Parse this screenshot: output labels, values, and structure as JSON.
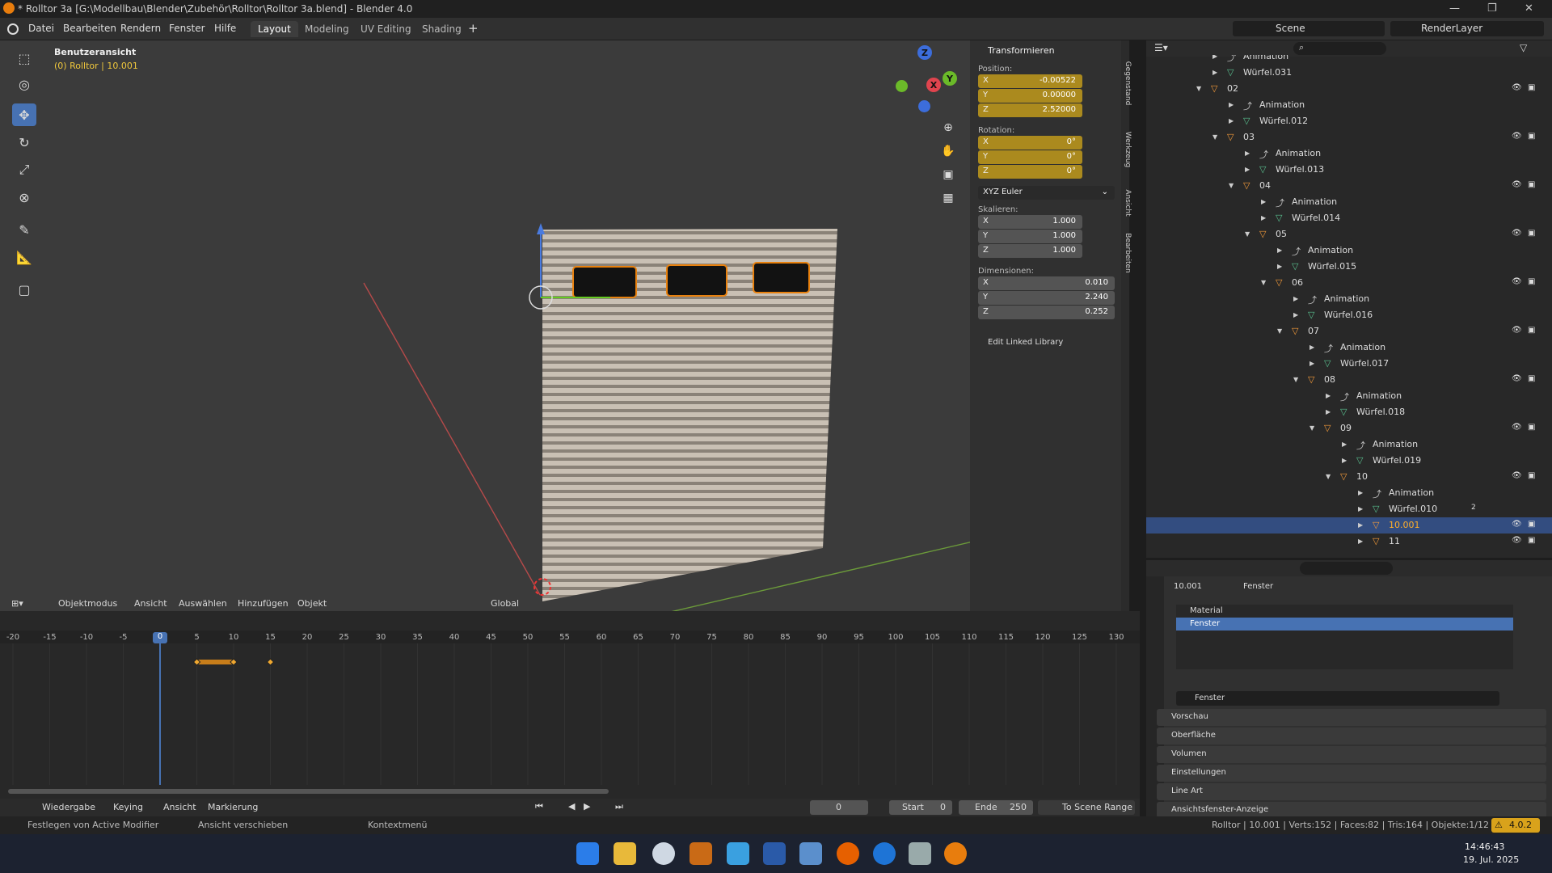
{
  "title_bar": {
    "title": "* Rolltor 3a [G:\\Modellbau\\Blender\\Zubehör\\Rolltor\\Rolltor 3a.blend] - Blender 4.0"
  },
  "menu": {
    "items": [
      "Datei",
      "Bearbeiten",
      "Rendern",
      "Fenster",
      "Hilfe"
    ]
  },
  "workspaces": [
    "Layout",
    "Modeling",
    "UV Editing",
    "Shading"
  ],
  "scene": {
    "scene_name": "Scene",
    "view_layer": "RenderLayer"
  },
  "viewport": {
    "view_name": "Benutzeransicht",
    "object_info": "(0) Rolltor | 10.001",
    "header": {
      "mode": "Objektmodus",
      "items": [
        "Ansicht",
        "Auswählen",
        "Hinzufügen",
        "Objekt"
      ],
      "orientation": "Global"
    },
    "gizmo": {
      "x": "X",
      "y": "Y",
      "z": "Z"
    }
  },
  "n_panel": {
    "header": "Transformieren",
    "position_label": "Position:",
    "position": [
      {
        "axis": "X",
        "value": "-0.00522"
      },
      {
        "axis": "Y",
        "value": "0.00000"
      },
      {
        "axis": "Z",
        "value": "2.52000"
      }
    ],
    "rotation_label": "Rotation:",
    "rotation": [
      {
        "axis": "X",
        "value": "0°"
      },
      {
        "axis": "Y",
        "value": "0°"
      },
      {
        "axis": "Z",
        "value": "0°"
      }
    ],
    "rotation_mode": "XYZ Euler",
    "scale_label": "Skalieren:",
    "scale": [
      {
        "axis": "X",
        "value": "1.000"
      },
      {
        "axis": "Y",
        "value": "1.000"
      },
      {
        "axis": "Z",
        "value": "1.000"
      }
    ],
    "dims_label": "Dimensionen:",
    "dims": [
      {
        "axis": "X",
        "value": "0.010"
      },
      {
        "axis": "Y",
        "value": "2.240"
      },
      {
        "axis": "Z",
        "value": "0.252"
      }
    ],
    "linked": "Edit Linked Library",
    "tabs": [
      "Gegenstand",
      "Werkzeug",
      "Ansicht",
      "Bearbeiten"
    ]
  },
  "outliner": {
    "rows": [
      {
        "label": "Animation",
        "indent": 4,
        "kind": "anim"
      },
      {
        "label": "Würfel.031",
        "indent": 4,
        "kind": "mesh"
      },
      {
        "label": "02",
        "indent": 3,
        "kind": "empty",
        "open": true
      },
      {
        "label": "Animation",
        "indent": 5,
        "kind": "anim"
      },
      {
        "label": "Würfel.012",
        "indent": 5,
        "kind": "mesh"
      },
      {
        "label": "03",
        "indent": 4,
        "kind": "empty",
        "open": true
      },
      {
        "label": "Animation",
        "indent": 6,
        "kind": "anim"
      },
      {
        "label": "Würfel.013",
        "indent": 6,
        "kind": "mesh"
      },
      {
        "label": "04",
        "indent": 5,
        "kind": "empty",
        "open": true
      },
      {
        "label": "Animation",
        "indent": 7,
        "kind": "anim"
      },
      {
        "label": "Würfel.014",
        "indent": 7,
        "kind": "mesh"
      },
      {
        "label": "05",
        "indent": 6,
        "kind": "empty",
        "open": true
      },
      {
        "label": "Animation",
        "indent": 8,
        "kind": "anim"
      },
      {
        "label": "Würfel.015",
        "indent": 8,
        "kind": "mesh"
      },
      {
        "label": "06",
        "indent": 7,
        "kind": "empty",
        "open": true
      },
      {
        "label": "Animation",
        "indent": 9,
        "kind": "anim"
      },
      {
        "label": "Würfel.016",
        "indent": 9,
        "kind": "mesh"
      },
      {
        "label": "07",
        "indent": 8,
        "kind": "empty",
        "open": true
      },
      {
        "label": "Animation",
        "indent": 10,
        "kind": "anim"
      },
      {
        "label": "Würfel.017",
        "indent": 10,
        "kind": "mesh"
      },
      {
        "label": "08",
        "indent": 9,
        "kind": "empty",
        "open": true
      },
      {
        "label": "Animation",
        "indent": 11,
        "kind": "anim"
      },
      {
        "label": "Würfel.018",
        "indent": 11,
        "kind": "mesh"
      },
      {
        "label": "09",
        "indent": 10,
        "kind": "empty",
        "open": true
      },
      {
        "label": "Animation",
        "indent": 12,
        "kind": "anim"
      },
      {
        "label": "Würfel.019",
        "indent": 12,
        "kind": "mesh"
      },
      {
        "label": "10",
        "indent": 11,
        "kind": "empty",
        "open": true
      },
      {
        "label": "Animation",
        "indent": 13,
        "kind": "anim"
      },
      {
        "label": "Würfel.010",
        "indent": 13,
        "kind": "mesh",
        "badge": "2"
      },
      {
        "label": "10.001",
        "indent": 13,
        "kind": "empty",
        "selected": true
      },
      {
        "label": "11",
        "indent": 13,
        "kind": "empty"
      }
    ]
  },
  "properties": {
    "breadcrumb": [
      "10.001",
      "Fenster"
    ],
    "slots": [
      "Material",
      "Fenster"
    ],
    "material_name": "Fenster",
    "sections": [
      "Vorschau",
      "Oberfläche",
      "Volumen",
      "Einstellungen",
      "Line Art",
      "Ansichtsfenster-Anzeige"
    ]
  },
  "timeline": {
    "frame_labels": [
      "-20",
      "-15",
      "-10",
      "-5",
      "0",
      "5",
      "10",
      "15",
      "20",
      "25",
      "30",
      "35",
      "40",
      "45",
      "50",
      "55",
      "60",
      "65",
      "70",
      "75",
      "80",
      "85",
      "90",
      "95",
      "100",
      "105",
      "110",
      "115",
      "120",
      "125",
      "130"
    ],
    "current_frame": 0,
    "header_items": [
      "Wiedergabe",
      "Keying",
      "Ansicht",
      "Markierung"
    ],
    "frame_field": "0",
    "start_label": "Start",
    "start": "0",
    "end_label": "Ende",
    "end": "250",
    "scene_range": "To Scene Range"
  },
  "status_bar": {
    "left": [
      "Festlegen von Active Modifier",
      "Ansicht verschieben",
      "Kontextmenü"
    ],
    "stats": "Rolltor | 10.001 | Verts:152 | Faces:82 | Tris:164 | Objekte:1/12",
    "version": "4.0.2"
  },
  "taskbar": {
    "time": "14:46:43",
    "date": "19. Jul. 2025"
  },
  "colors": {
    "accent": "#4772b3",
    "field_gold": "#ab8a1e",
    "selected_row": "#334d80",
    "selected_text": "#ffaf29",
    "orange": "#e8810e"
  }
}
